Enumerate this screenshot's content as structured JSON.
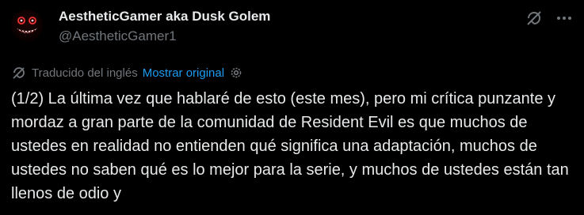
{
  "author": {
    "display_name": "AestheticGamer aka Dusk Golem",
    "handle": "@AestheticGamer1"
  },
  "icons": {
    "avatar": "demon-face-avatar",
    "grok": "grok-icon",
    "more": "more-options-icon",
    "translate": "translate-icon",
    "settings": "gear-icon"
  },
  "translation": {
    "label": "Traducido del inglés",
    "show_original": "Mostrar original"
  },
  "tweet": {
    "text": "(1/2) La última vez que hablaré de esto (este mes), pero mi crítica punzante y mordaz a gran parte de la comunidad de Resident Evil es que muchos de ustedes en realidad no entienden qué significa una adaptación, muchos de ustedes no saben qué es lo mejor para la serie, y muchos de ustedes están tan llenos de odio y"
  },
  "colors": {
    "background": "#000000",
    "primary_text": "#e7e9ea",
    "secondary_text": "#71767b",
    "accent": "#1d9bf0"
  }
}
